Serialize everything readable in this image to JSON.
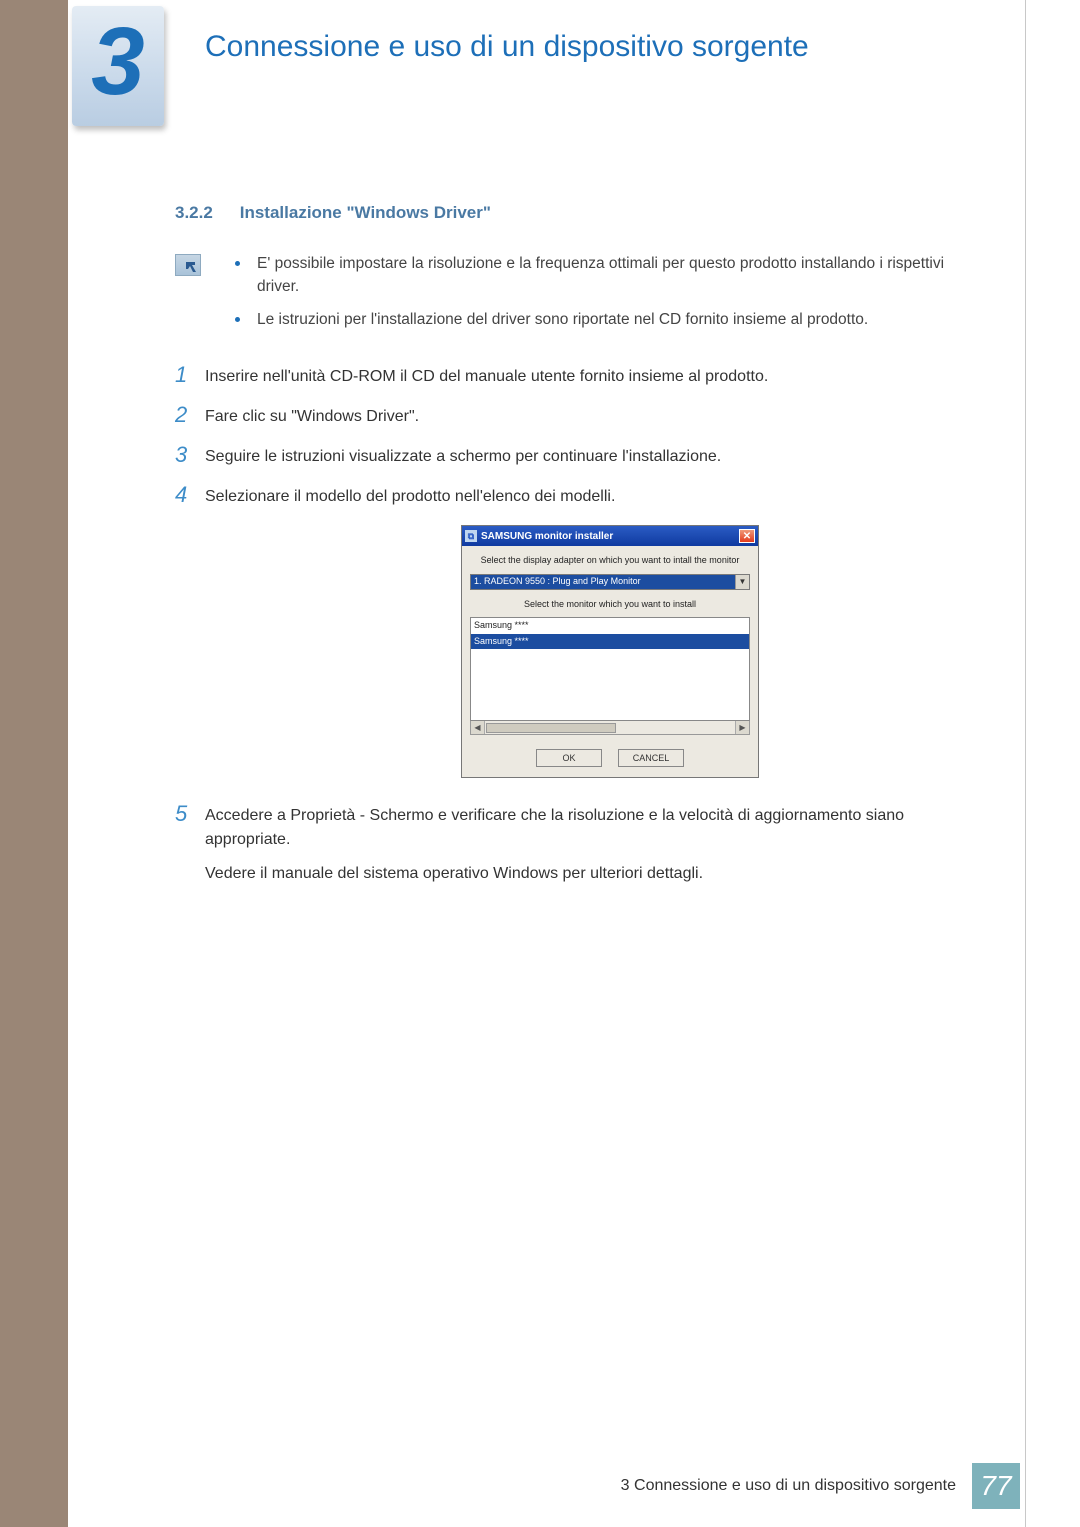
{
  "chapter": {
    "number": "3",
    "title": "Connessione e uso di un dispositivo sorgente"
  },
  "subsection": {
    "number": "3.2.2",
    "title": "Installazione \"Windows Driver\""
  },
  "notes": [
    "E' possibile impostare la risoluzione e la frequenza ottimali per questo prodotto installando i rispettivi driver.",
    "Le istruzioni per l'installazione del driver sono riportate nel CD fornito insieme al prodotto."
  ],
  "steps": [
    {
      "n": "1",
      "text": "Inserire nell'unità CD-ROM il CD del manuale utente fornito insieme al prodotto."
    },
    {
      "n": "2",
      "text": "Fare clic su \"Windows Driver\"."
    },
    {
      "n": "3",
      "text": "Seguire le istruzioni visualizzate a schermo per continuare l'installazione."
    },
    {
      "n": "4",
      "text": "Selezionare il modello del prodotto nell'elenco dei modelli."
    },
    {
      "n": "5",
      "text": "Accedere a Proprietà - Schermo e verificare che la risoluzione e la velocità di aggiornamento siano appropriate.",
      "extra": "Vedere il manuale del sistema operativo Windows per ulteriori dettagli."
    }
  ],
  "dialog": {
    "title": "SAMSUNG monitor installer",
    "label_adapter": "Select the display adapter on which you want to intall the monitor",
    "adapter_value": "1. RADEON 9550 : Plug and Play Monitor",
    "label_monitor": "Select the monitor which you want to install",
    "list": [
      "Samsung ****",
      "Samsung ****"
    ],
    "btn_ok": "OK",
    "btn_cancel": "CANCEL"
  },
  "footer": {
    "chapter_ref": "3",
    "chapter_title": "Connessione e uso di un dispositivo sorgente",
    "page_number": "77"
  }
}
